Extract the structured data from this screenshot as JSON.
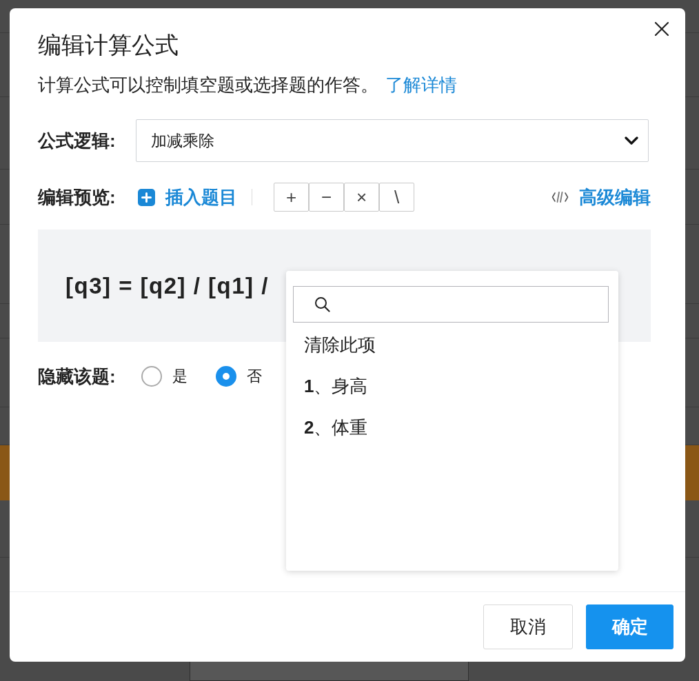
{
  "dialog": {
    "title": "编辑计算公式"
  },
  "description": {
    "text": "计算公式可以控制填空题或选择题的作答。",
    "link": "了解详情"
  },
  "formula_logic": {
    "label": "公式逻辑:",
    "value": "加减乘除"
  },
  "preview_toolbar": {
    "label": "编辑预览:",
    "insert_button": "插入题目",
    "operators": [
      "+",
      "−",
      "×",
      "\\"
    ],
    "advanced_button": "高级编辑"
  },
  "formula_preview": {
    "text": "[q3] = [q2] / [q1] /"
  },
  "hide_question": {
    "label": "隐藏该题:",
    "options": [
      {
        "label": "是",
        "selected": false
      },
      {
        "label": "否",
        "selected": true
      }
    ]
  },
  "question_dropdown": {
    "items": [
      "清除此项",
      "**1**、身高",
      "**2**、体重"
    ]
  },
  "buttons": [
    {
      "label": "取消",
      "kind": "secondary"
    },
    {
      "label": "确定",
      "kind": "primary"
    }
  ]
}
